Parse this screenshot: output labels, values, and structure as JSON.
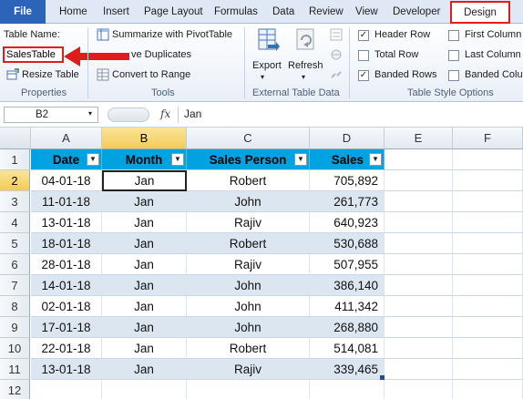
{
  "tabs": {
    "file": "File",
    "items": [
      "Home",
      "Insert",
      "Page Layout",
      "Formulas",
      "Data",
      "Review",
      "View",
      "Developer"
    ],
    "design": "Design"
  },
  "ribbon": {
    "properties": {
      "table_name_label": "Table Name:",
      "table_name_value": "SalesTable",
      "resize_table": "Resize Table",
      "group_label": "Properties"
    },
    "tools": {
      "summarize": "Summarize with PivotTable",
      "remove_duplicates": "ve Duplicates",
      "convert": "Convert to Range",
      "group_label": "Tools"
    },
    "external": {
      "export": "Export",
      "refresh": "Refresh",
      "group_label": "External Table Data"
    },
    "style_options": {
      "header_row": "Header Row",
      "total_row": "Total Row",
      "banded_rows": "Banded Rows",
      "first_column": "First Column",
      "last_column": "Last Column",
      "banded_columns": "Banded Colu",
      "header_row_checked": true,
      "total_row_checked": false,
      "banded_rows_checked": true,
      "first_column_checked": false,
      "last_column_checked": false,
      "banded_columns_checked": false,
      "group_label": "Table Style Options"
    }
  },
  "formula_bar": {
    "name_box": "B2",
    "fx": "fx",
    "content": "Jan"
  },
  "sheet": {
    "columns": [
      "A",
      "B",
      "C",
      "D",
      "E",
      "F"
    ],
    "rows": [
      "1",
      "2",
      "3",
      "4",
      "5",
      "6",
      "7",
      "8",
      "9",
      "10",
      "11",
      "12"
    ],
    "headers": [
      "Date",
      "Month",
      "Sales Person",
      "Sales"
    ],
    "data": [
      [
        "04-01-18",
        "Jan",
        "Robert",
        "705,892"
      ],
      [
        "11-01-18",
        "Jan",
        "John",
        "261,773"
      ],
      [
        "13-01-18",
        "Jan",
        "Rajiv",
        "640,923"
      ],
      [
        "18-01-18",
        "Jan",
        "Robert",
        "530,688"
      ],
      [
        "28-01-18",
        "Jan",
        "Rajiv",
        "507,955"
      ],
      [
        "14-01-18",
        "Jan",
        "John",
        "386,140"
      ],
      [
        "02-01-18",
        "Jan",
        "John",
        "411,342"
      ],
      [
        "17-01-18",
        "Jan",
        "John",
        "268,880"
      ],
      [
        "22-01-18",
        "Jan",
        "Robert",
        "514,081"
      ],
      [
        "13-01-18",
        "Jan",
        "Rajiv",
        "339,465"
      ]
    ]
  },
  "colors": {
    "table_header": "#00a3e0",
    "band": "#dce6f1",
    "highlight": "#e21b1b",
    "file_tab": "#2b64b8"
  }
}
